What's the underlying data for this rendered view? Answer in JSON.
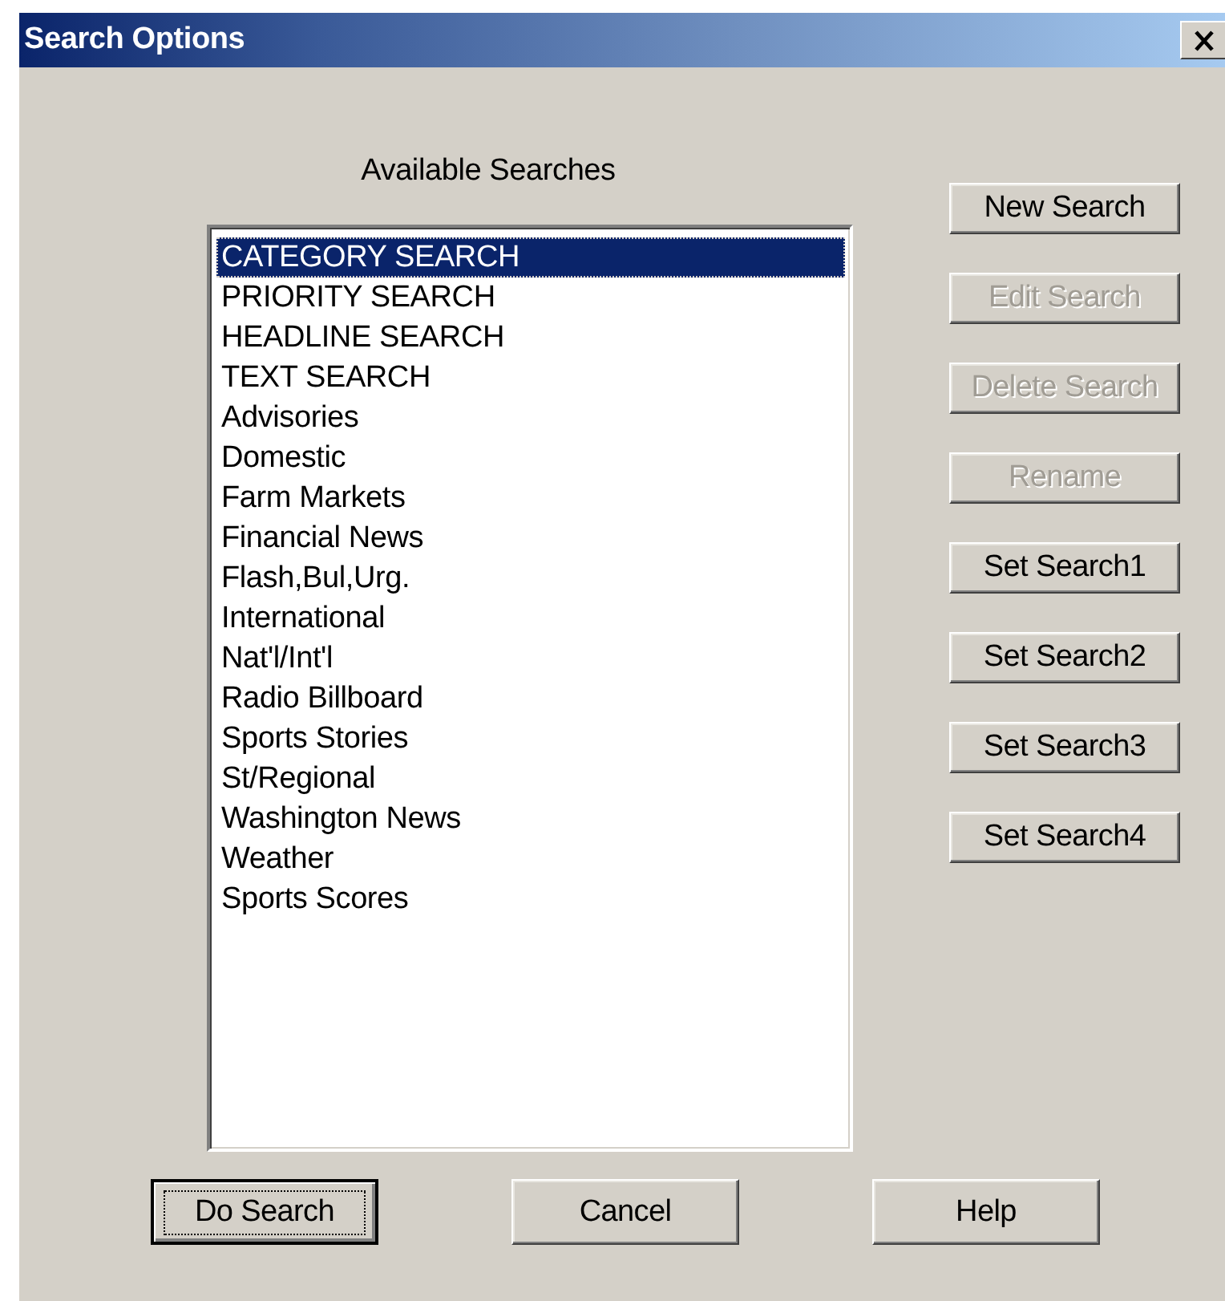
{
  "window": {
    "title": "Search Options"
  },
  "searches": {
    "label": "Available Searches",
    "items": [
      {
        "label": "CATEGORY SEARCH",
        "selected": true
      },
      {
        "label": "PRIORITY SEARCH",
        "selected": false
      },
      {
        "label": "HEADLINE SEARCH",
        "selected": false
      },
      {
        "label": "TEXT SEARCH",
        "selected": false
      },
      {
        "label": "Advisories",
        "selected": false
      },
      {
        "label": "Domestic",
        "selected": false
      },
      {
        "label": "Farm Markets",
        "selected": false
      },
      {
        "label": "Financial News",
        "selected": false
      },
      {
        "label": "Flash,Bul,Urg.",
        "selected": false
      },
      {
        "label": "International",
        "selected": false
      },
      {
        "label": "Nat'l/Int'l",
        "selected": false
      },
      {
        "label": "Radio Billboard",
        "selected": false
      },
      {
        "label": "Sports Stories",
        "selected": false
      },
      {
        "label": "St/Regional",
        "selected": false
      },
      {
        "label": "Washington News",
        "selected": false
      },
      {
        "label": "Weather",
        "selected": false
      },
      {
        "label": "Sports Scores",
        "selected": false
      }
    ]
  },
  "side_buttons": [
    {
      "label": "New Search",
      "disabled": false
    },
    {
      "label": "Edit Search",
      "disabled": true
    },
    {
      "label": "Delete Search",
      "disabled": true
    },
    {
      "label": "Rename",
      "disabled": true
    },
    {
      "label": "Set Search1",
      "disabled": false
    },
    {
      "label": "Set Search2",
      "disabled": false
    },
    {
      "label": "Set Search3",
      "disabled": false
    },
    {
      "label": "Set Search4",
      "disabled": false
    }
  ],
  "bottom_buttons": [
    {
      "label": "Do Search",
      "default": true
    },
    {
      "label": "Cancel",
      "default": false
    },
    {
      "label": "Help",
      "default": false
    }
  ]
}
